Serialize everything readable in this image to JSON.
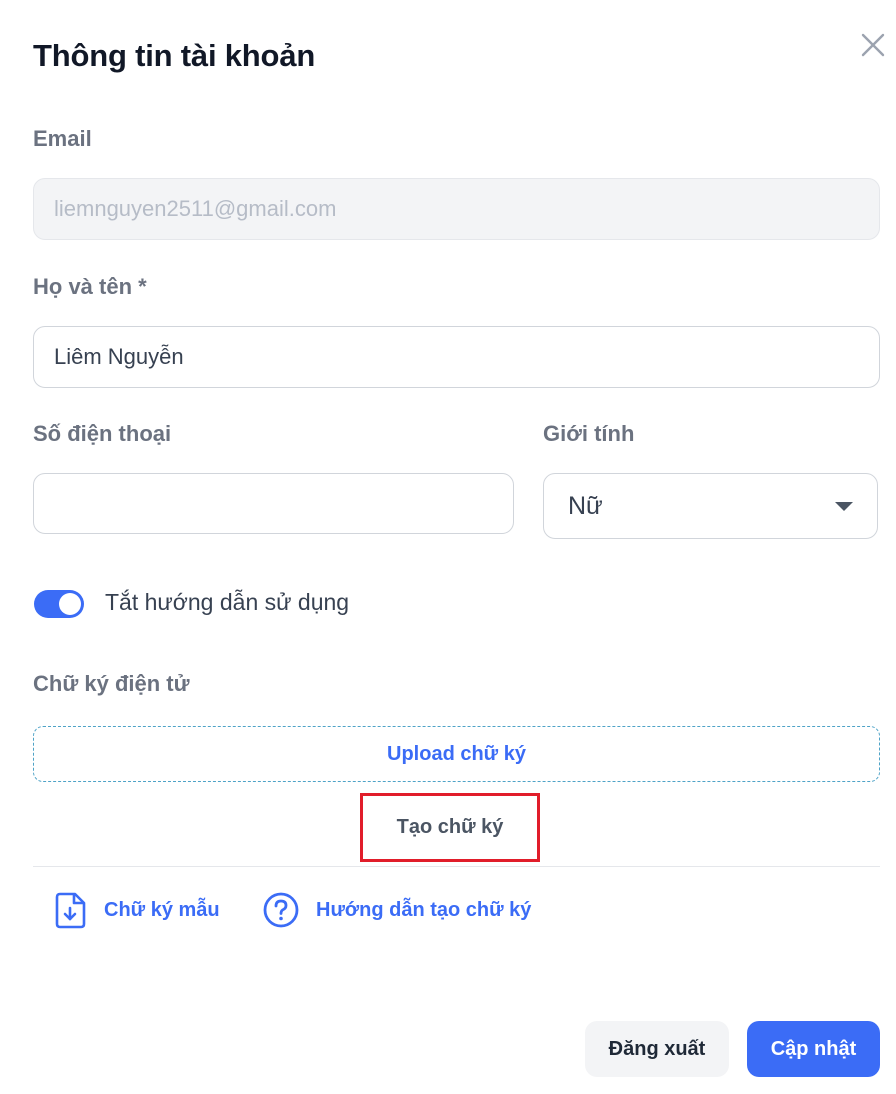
{
  "dialog": {
    "title": "Thông tin tài khoản"
  },
  "form": {
    "email": {
      "label": "Email",
      "value": "liemnguyen2511@gmail.com"
    },
    "full_name": {
      "label": "Họ và tên *",
      "value": "Liêm Nguyễn"
    },
    "phone": {
      "label": "Số điện thoại",
      "value": ""
    },
    "gender": {
      "label": "Giới tính",
      "value": "Nữ"
    },
    "toggle": {
      "label": "Tắt hướng dẫn sử dụng",
      "on": true
    }
  },
  "signature": {
    "label": "Chữ ký điện tử",
    "upload_label": "Upload chữ ký",
    "create_label": "Tạo chữ ký",
    "sample_link": "Chữ ký mẫu",
    "guide_link": "Hướng dẫn tạo chữ ký"
  },
  "footer": {
    "logout_label": "Đăng xuất",
    "update_label": "Cập nhật"
  },
  "colors": {
    "accent": "#3b6cf6",
    "highlight_border": "#e11d2a"
  }
}
